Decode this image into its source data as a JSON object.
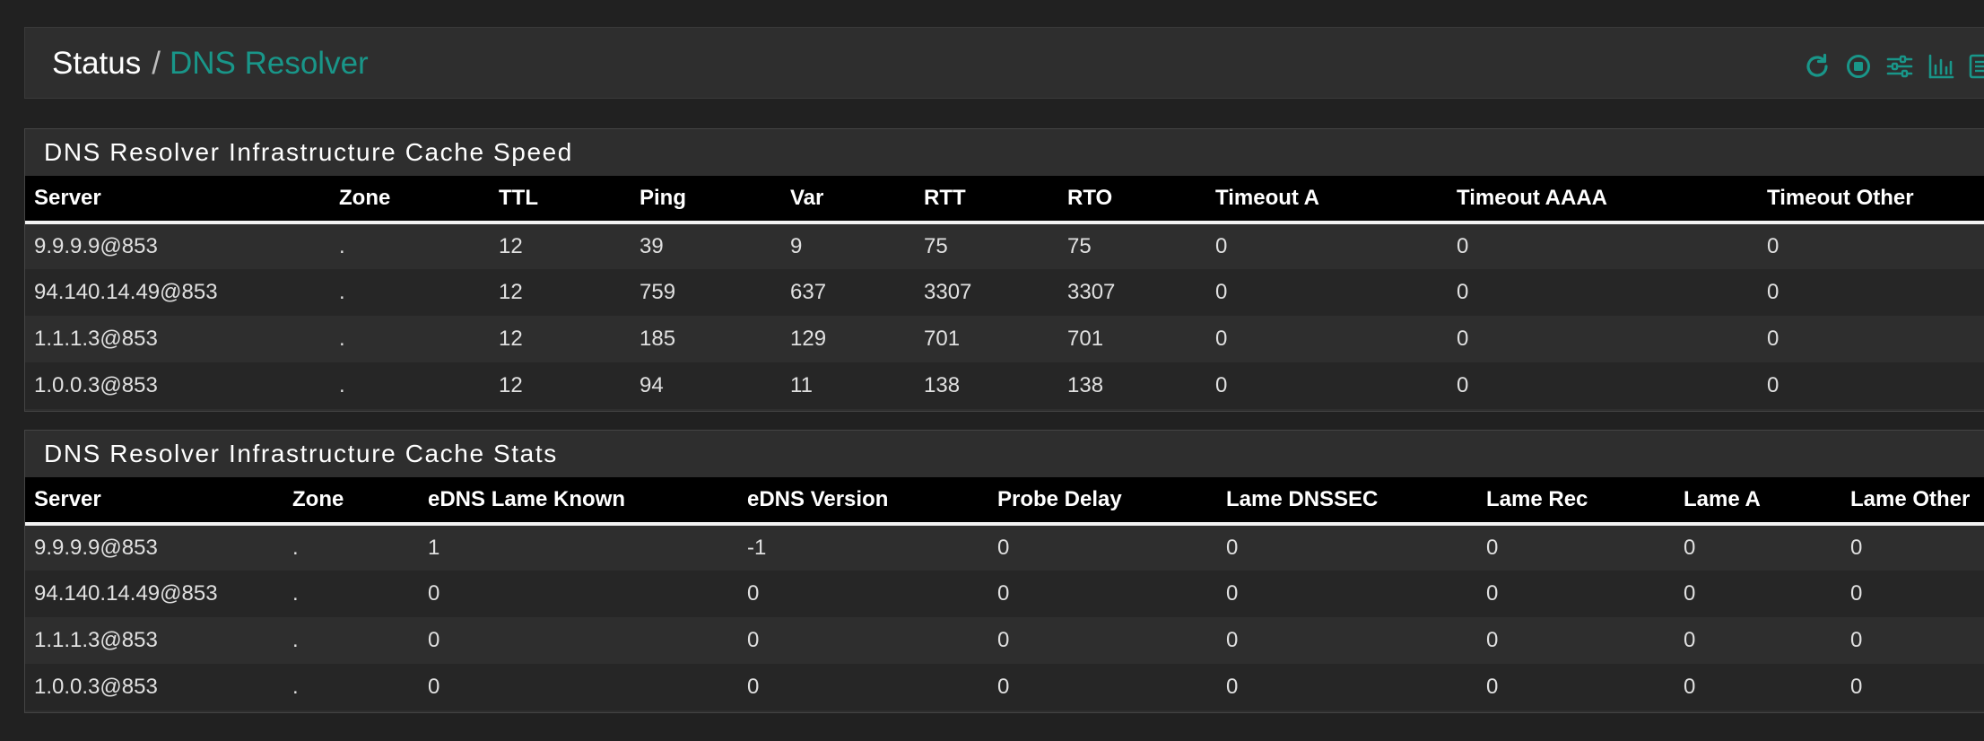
{
  "breadcrumb": {
    "root": "Status",
    "separator": "/",
    "current": "DNS Resolver"
  },
  "toolbar": [
    {
      "name": "refresh-icon"
    },
    {
      "name": "stop-circle-icon"
    },
    {
      "name": "sliders-icon"
    },
    {
      "name": "bar-chart-icon"
    },
    {
      "name": "log-list-icon"
    }
  ],
  "colors": {
    "accent": "#199689",
    "background": "#212121",
    "panel": "#2e2e2e",
    "table_header": "#000000"
  },
  "speed_table": {
    "title": "DNS Resolver Infrastructure Cache Speed",
    "columns": [
      "Server",
      "Zone",
      "TTL",
      "Ping",
      "Var",
      "RTT",
      "RTO",
      "Timeout A",
      "Timeout AAAA",
      "Timeout Other"
    ],
    "rows": [
      [
        "9.9.9.9@853",
        ".",
        "12",
        "39",
        "9",
        "75",
        "75",
        "0",
        "0",
        "0"
      ],
      [
        "94.140.14.49@853",
        ".",
        "12",
        "759",
        "637",
        "3307",
        "3307",
        "0",
        "0",
        "0"
      ],
      [
        "1.1.1.3@853",
        ".",
        "12",
        "185",
        "129",
        "701",
        "701",
        "0",
        "0",
        "0"
      ],
      [
        "1.0.0.3@853",
        ".",
        "12",
        "94",
        "11",
        "138",
        "138",
        "0",
        "0",
        "0"
      ]
    ]
  },
  "stats_table": {
    "title": "DNS Resolver Infrastructure Cache Stats",
    "columns": [
      "Server",
      "Zone",
      "eDNS Lame Known",
      "eDNS Version",
      "Probe Delay",
      "Lame DNSSEC",
      "Lame Rec",
      "Lame A",
      "Lame Other"
    ],
    "rows": [
      [
        "9.9.9.9@853",
        ".",
        "1",
        "-1",
        "0",
        "0",
        "0",
        "0",
        "0"
      ],
      [
        "94.140.14.49@853",
        ".",
        "0",
        "0",
        "0",
        "0",
        "0",
        "0",
        "0"
      ],
      [
        "1.1.1.3@853",
        ".",
        "0",
        "0",
        "0",
        "0",
        "0",
        "0",
        "0"
      ],
      [
        "1.0.0.3@853",
        ".",
        "0",
        "0",
        "0",
        "0",
        "0",
        "0",
        "0"
      ]
    ]
  }
}
